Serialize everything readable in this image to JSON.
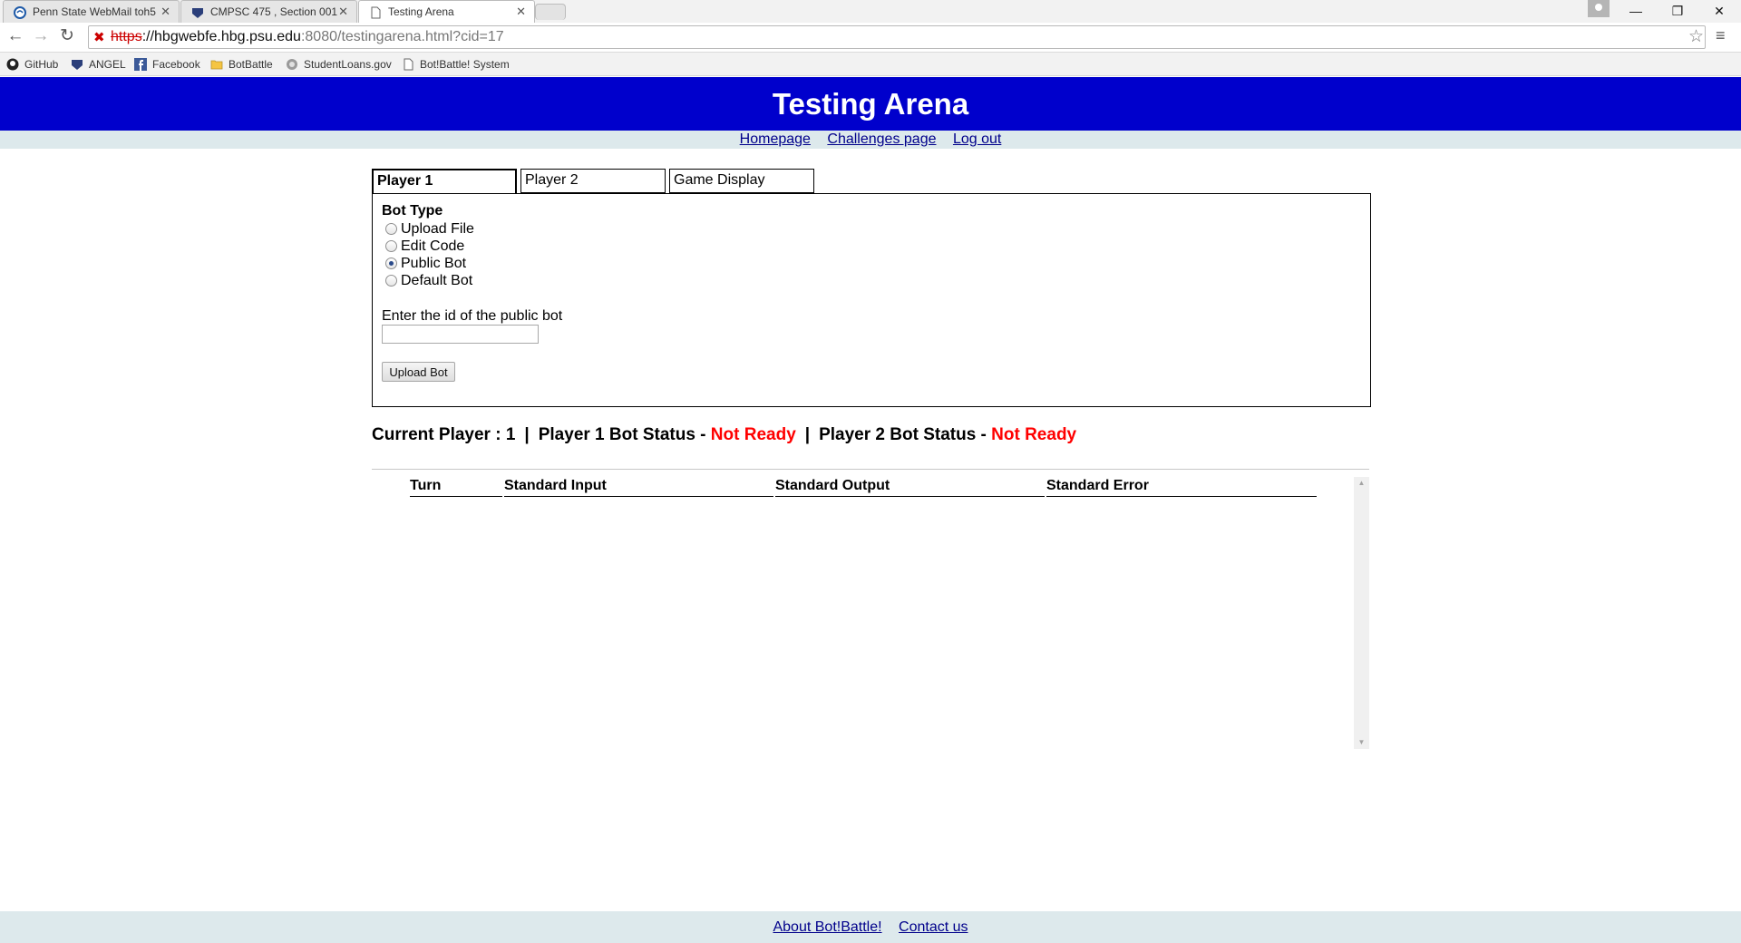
{
  "browser": {
    "tabs": [
      {
        "title": "Penn State WebMail toh5",
        "active": false
      },
      {
        "title": "CMPSC 475 , Section 001",
        "active": false
      },
      {
        "title": "Testing Arena",
        "active": true
      }
    ],
    "url": {
      "scheme": "https",
      "sep": "://",
      "host": "hbgwebfe.hbg.psu.edu",
      "path": ":8080/testingarena.html?cid=17"
    },
    "bookmarks": [
      {
        "label": "GitHub",
        "icon": "github-icon"
      },
      {
        "label": "ANGEL",
        "icon": "shield-icon"
      },
      {
        "label": "Facebook",
        "icon": "facebook-icon"
      },
      {
        "label": "BotBattle",
        "icon": "folder-icon"
      },
      {
        "label": "StudentLoans.gov",
        "icon": "seal-icon"
      },
      {
        "label": "Bot!Battle! System",
        "icon": "page-icon"
      }
    ]
  },
  "page": {
    "title": "Testing Arena",
    "nav": [
      "Homepage",
      "Challenges page",
      "Log out"
    ],
    "player_tabs": [
      "Player 1",
      "Player 2",
      "Game Display"
    ],
    "bot_type": {
      "heading": "Bot Type",
      "options": [
        "Upload File",
        "Edit Code",
        "Public Bot",
        "Default Bot"
      ],
      "selected": "Public Bot"
    },
    "public_bot_prompt": "Enter the id of the public bot",
    "public_bot_id": "",
    "upload_button": "Upload Bot",
    "status": {
      "current_player_label": "Current Player : 1",
      "p1_label": "Player 1 Bot Status - ",
      "p1_value": "Not Ready",
      "p2_label": "Player 2 Bot Status - ",
      "p2_value": "Not Ready",
      "separator": "|"
    },
    "log_columns": [
      "Turn",
      "Standard Input",
      "Standard Output",
      "Standard Error"
    ],
    "footer_links": [
      "About Bot!Battle!",
      "Contact us"
    ]
  },
  "colors": {
    "banner": "#0000cc",
    "link": "#00008b",
    "not_ready": "#ff0000",
    "subnav_bg": "#dde9ec"
  }
}
